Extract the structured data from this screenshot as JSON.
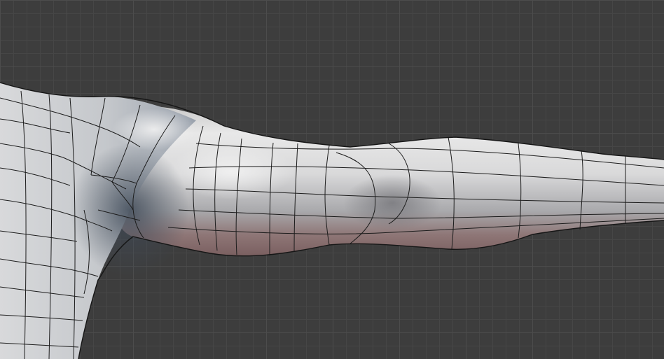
{
  "viewport": {
    "background_color": "#3d3d3d",
    "grid_minor_color": "#464646",
    "grid_major_color": "#4c4c4c"
  },
  "mesh": {
    "surface_light": "#e6e6e6",
    "surface_mid": "#b9bbbe",
    "surface_shadow": "#5f6976",
    "underside_tint": "#9a7070",
    "wire_color": "#1c1c1c"
  }
}
